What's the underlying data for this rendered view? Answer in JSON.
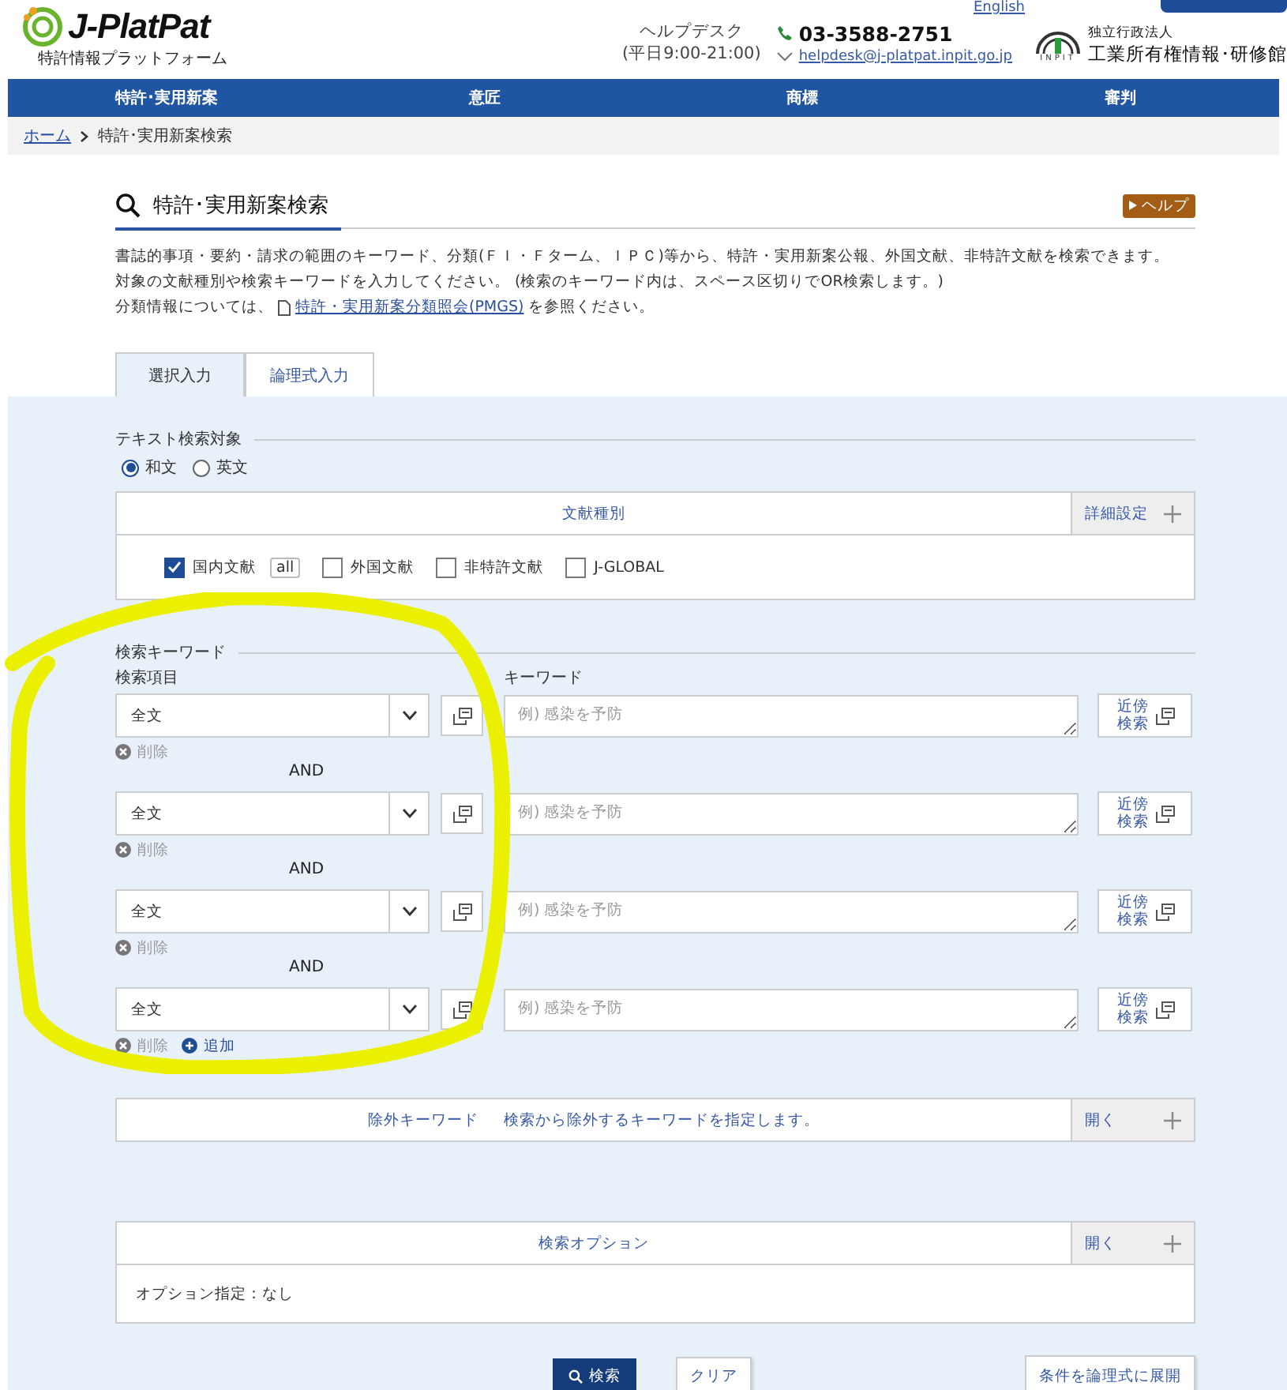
{
  "header": {
    "logo_text": "J-PlatPat",
    "logo_subtitle": "特許情報プラットフォーム",
    "top_link": "English",
    "helpdesk_label": "ヘルプデスク",
    "helpdesk_hours": "(平日9:00-21:00)",
    "phone": "03-3588-2751",
    "email": "helpdesk@j-platpat.inpit.go.jp",
    "org_small": "独立行政法人",
    "org_name": "工業所有権情報･研修館",
    "org_logo_text": "INPIT"
  },
  "nav": [
    "特許･実用新案",
    "意匠",
    "商標",
    "審判"
  ],
  "breadcrumb": {
    "home": "ホーム",
    "current": "特許･実用新案検索"
  },
  "title": "特許･実用新案検索",
  "help_button": "ヘルプ",
  "description": [
    "書誌的事項・要約・請求の範囲のキーワード、分類(ＦＩ・Ｆターム、ＩＰＣ)等から、特許・実用新案公報、外国文献、非特許文献を検索できます。",
    "対象の文献種別や検索キーワードを入力してください。 (検索のキーワード内は、スペース区切りでOR検索します。)"
  ],
  "pmgs_line": {
    "before": "分類情報については、",
    "link": "特許・実用新案分類照会(PMGS)",
    "after": "を参照ください。"
  },
  "tabs": [
    {
      "label": "選択入力",
      "selected": true
    },
    {
      "label": "論理式入力",
      "selected": false
    }
  ],
  "text_target": {
    "label": "テキスト検索対象",
    "options": [
      {
        "label": "和文",
        "selected": true
      },
      {
        "label": "英文",
        "selected": false
      }
    ]
  },
  "doc_types": {
    "title": "文献種別",
    "detail_button": "詳細設定",
    "items": [
      {
        "label": "国内文献",
        "checked": true,
        "badge": "all"
      },
      {
        "label": "外国文献",
        "checked": false
      },
      {
        "label": "非特許文献",
        "checked": false
      },
      {
        "label": "J-GLOBAL",
        "checked": false
      }
    ]
  },
  "keywords": {
    "section_label": "検索キーワード",
    "column_field": "検索項目",
    "column_keyword": "キーワード",
    "rows": [
      {
        "field": "全文",
        "placeholder": "例) 感染を予防",
        "proximity_button": "近傍検索",
        "delete": "削除",
        "operator": "AND"
      },
      {
        "field": "全文",
        "placeholder": "例) 感染を予防",
        "proximity_button": "近傍検索",
        "delete": "削除",
        "operator": "AND"
      },
      {
        "field": "全文",
        "placeholder": "例) 感染を予防",
        "proximity_button": "近傍検索",
        "delete": "削除",
        "operator": "AND"
      },
      {
        "field": "全文",
        "placeholder": "例) 感染を予防",
        "proximity_button": "近傍検索",
        "delete": "削除",
        "add": "追加"
      }
    ]
  },
  "exclude": {
    "title": "除外キーワード",
    "hint": "検索から除外するキーワードを指定します。",
    "toggle": "開く"
  },
  "options": {
    "title": "検索オプション",
    "toggle": "開く",
    "summary": "オプション指定：なし"
  },
  "actions": {
    "search": "検索",
    "clear": "クリア",
    "expand": "条件を論理式に展開"
  }
}
